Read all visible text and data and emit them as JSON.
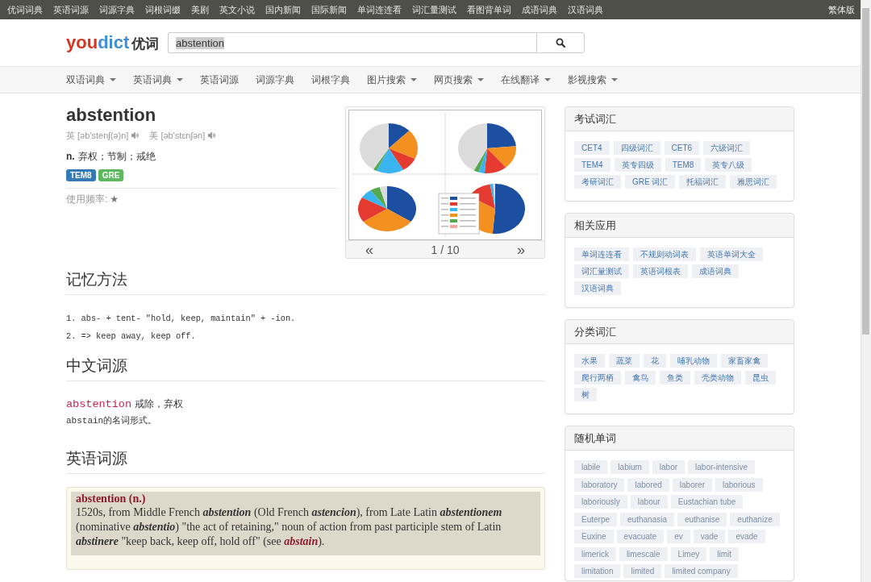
{
  "top_bar": {
    "links": [
      "优词词典",
      "英语词源",
      "词源字典",
      "词根词缀",
      "美剧",
      "英文小说",
      "国内新闻",
      "国际新闻",
      "单词连连看",
      "词汇量测试",
      "看图背单词",
      "成语词典",
      "汉语词典"
    ],
    "traditional_link": "繁体版"
  },
  "header": {
    "logo": {
      "part_1": "you",
      "part_2": "dict",
      "part_3": "优词"
    },
    "search": {
      "value": "abstention",
      "selected": true
    }
  },
  "nav": [
    {
      "label": "双语词典",
      "has_menu": true
    },
    {
      "label": "英语词典",
      "has_menu": true
    },
    {
      "label": "英语词源",
      "has_menu": false
    },
    {
      "label": "词源字典",
      "has_menu": false
    },
    {
      "label": "词根字典",
      "has_menu": false
    },
    {
      "label": "图片搜索",
      "has_menu": true
    },
    {
      "label": "网页搜索",
      "has_menu": true
    },
    {
      "label": "在线翻译",
      "has_menu": true
    },
    {
      "label": "影视搜索",
      "has_menu": true
    }
  ],
  "entry": {
    "word": "abstention",
    "pronunciations": [
      {
        "region": "英",
        "phonetic": "[əb'stenʃ(ə)n]"
      },
      {
        "region": "美",
        "phonetic": "[əb'stɛnʃən]"
      }
    ],
    "definition": {
      "pos": "n.",
      "meaning": "弃权；节制；戒绝"
    },
    "tags": [
      {
        "label": "TEM8",
        "color": "#337ab7"
      },
      {
        "label": "GRE",
        "color": "#5cb85c"
      }
    ],
    "frequency": {
      "label": "使用频率:",
      "rating": "★"
    }
  },
  "image_carousel": {
    "prev": "«",
    "counter": "1 / 10",
    "next": "»"
  },
  "sections": [
    {
      "kind": "list",
      "title": "记忆方法",
      "items": [
        "1. abs- + tent- \"hold, keep, maintain\" + -ion.",
        "2. => keep away, keep off."
      ]
    },
    {
      "kind": "gloss",
      "title": "中文词源",
      "term": "abstention",
      "gloss": "戒除，弃权",
      "note": "abstain的名词形式。"
    },
    {
      "kind": "etymology",
      "title": "英语词源",
      "heading": "abstention (n.)",
      "text": "1520s, from Middle French **abstention** (Old French **astencion**), from Late Latin **abstentionem** (nominative **abstentio**) \"the act of retaining,\" noun of action from past participle stem of Latin **abstinere** \"keep back, keep off, hold off\" (see ",
      "link": "abstain",
      "after": ")."
    }
  ],
  "sidebar": [
    {
      "kind": "links",
      "title": "考试词汇",
      "items": [
        "CET4",
        "四级词汇",
        "CET6",
        "六级词汇",
        "TEM4",
        "英专四级",
        "TEM8",
        "英专八级",
        "考研词汇",
        "GRE 词汇",
        "托福词汇",
        "雅思词汇"
      ]
    },
    {
      "kind": "links",
      "title": "相关应用",
      "items": [
        "单词连连看",
        "不规则动词表",
        "英语单词大全",
        "词汇量测试",
        "英语词根表",
        "成语词典",
        "汉语词典"
      ]
    },
    {
      "kind": "links",
      "title": "分类词汇",
      "items": [
        "水果",
        "蔬菜",
        "花",
        "哺乳动物",
        "家畜家禽",
        "爬行两栖",
        "禽鸟",
        "鱼类",
        "壳类动物",
        "昆虫",
        "树"
      ]
    },
    {
      "kind": "words",
      "title": "随机单词",
      "items": [
        "labile",
        "labium",
        "labor",
        "labor-intensive",
        "laboratory",
        "labored",
        "laborer",
        "laborious",
        "laboriously",
        "labour",
        "Eustachian tube",
        "Euterpe",
        "euthanasia",
        "euthanise",
        "euthanize",
        "Euxine",
        "evacuate",
        "ev",
        "vade",
        "evade",
        "limerick",
        "limescale",
        "Limey",
        "limit",
        "limitation",
        "limited",
        "limited company"
      ]
    }
  ]
}
